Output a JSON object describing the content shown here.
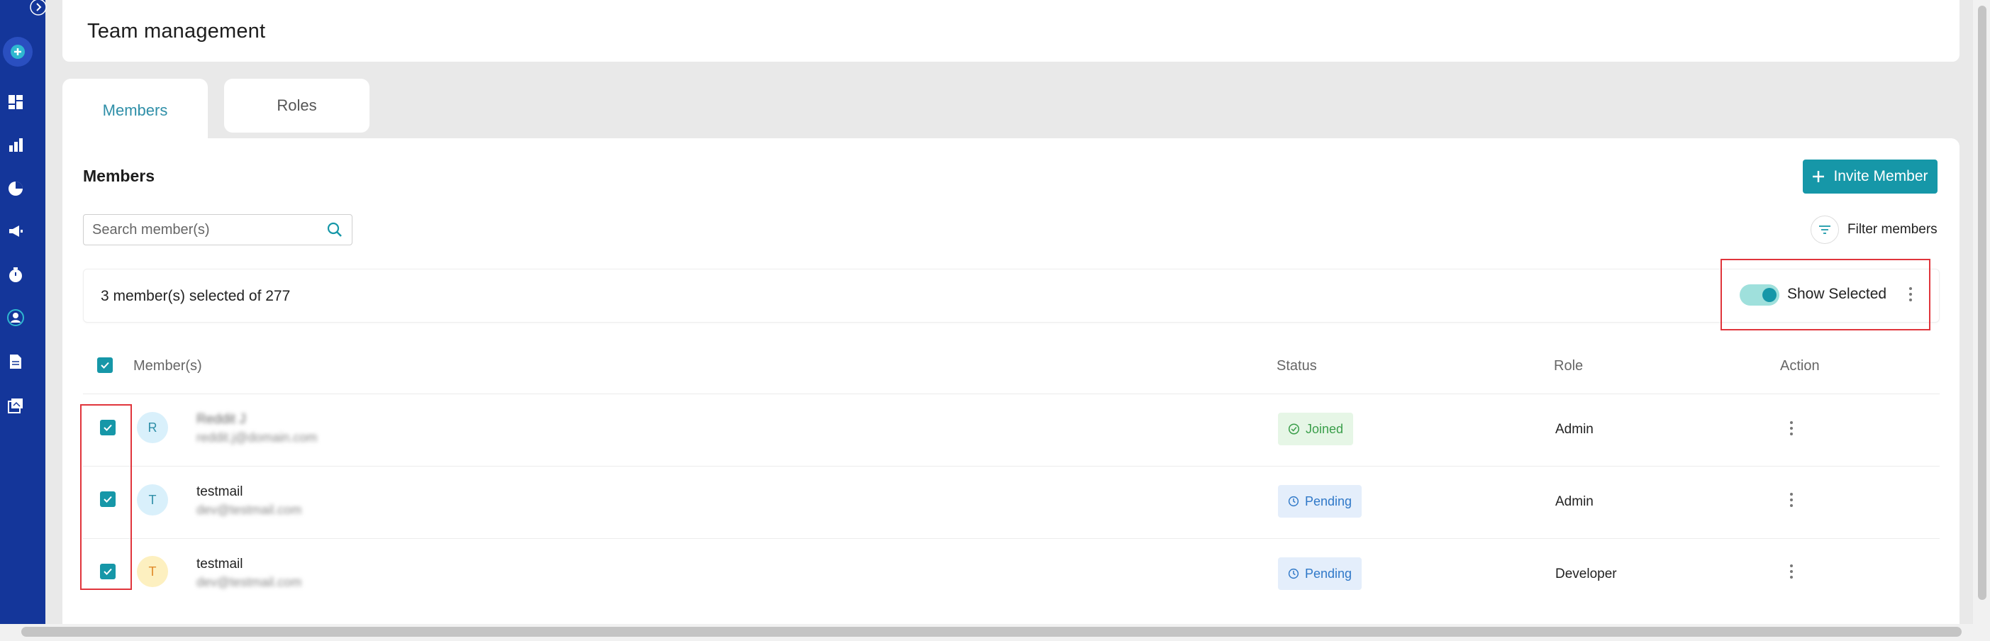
{
  "page": {
    "title": "Team management"
  },
  "tabs": [
    {
      "label": "Members",
      "active": true
    },
    {
      "label": "Roles",
      "active": false
    }
  ],
  "members_section": {
    "title": "Members",
    "invite_button_label": "Invite Member",
    "search_placeholder": "Search member(s)",
    "filter_label": "Filter members",
    "selection_text": "3 member(s) selected of 277",
    "show_selected_label": "Show Selected",
    "show_selected_on": true
  },
  "table": {
    "columns": [
      "Member(s)",
      "Status",
      "Role",
      "Action"
    ],
    "rows": [
      {
        "initial": "R",
        "name": "Reddit J",
        "email": "reddit.j@domain.com",
        "status": "Joined",
        "role": "Admin",
        "selected": true
      },
      {
        "initial": "T",
        "name": "testmail",
        "email": "dev@testmail.com",
        "status": "Pending",
        "role": "Admin",
        "selected": true
      },
      {
        "initial": "T",
        "name": "testmail",
        "email": "dev@testmail.com",
        "status": "Pending",
        "role": "Developer",
        "selected": true
      }
    ]
  },
  "colors": {
    "sidebar": "#14369a",
    "accent": "#1697a8",
    "joined": "#3a9e4a",
    "pending": "#2f78c8",
    "highlight": "#e0353c"
  },
  "sidebar_icons": [
    "expand-icon",
    "add-icon",
    "dashboard-icon",
    "bar-chart-icon",
    "pie-chart-icon",
    "megaphone-icon",
    "timer-icon",
    "team-icon",
    "document-icon",
    "gallery-icon"
  ]
}
